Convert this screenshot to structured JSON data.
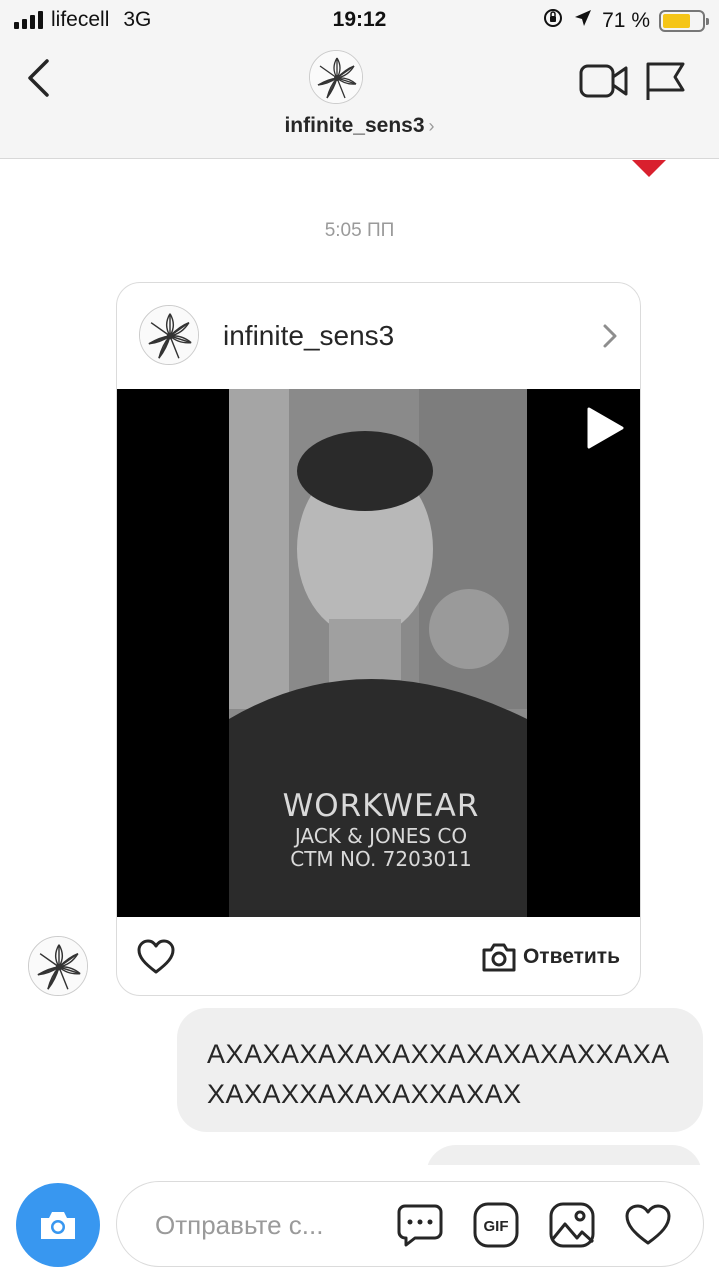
{
  "status_bar": {
    "carrier": "lifecell",
    "network": "3G",
    "time": "19:12",
    "battery_percent": "71 %",
    "battery_level": 0.71
  },
  "header": {
    "username": "infinite_sens3",
    "chevron": "›",
    "back_icon": "chevron-left-icon",
    "video_icon": "video-camera-icon",
    "flag_icon": "flag-icon"
  },
  "chat": {
    "timestamp": "5:05 ПП",
    "shared_post": {
      "username": "infinite_sens3",
      "shirt_line1": "WORKWEAR",
      "shirt_line2": "JACK & JONES CO",
      "shirt_line3": "CTM NO. 7203011",
      "reply_label": "Ответить"
    },
    "message_text": "АХАХАХАХАХАХХАХАХАХАХХАХАХАХАХХАХАХАХХАХАХ"
  },
  "composer": {
    "placeholder": "Отправьте с..."
  },
  "colors": {
    "accent": "#3897f0",
    "notification": "#d9202e",
    "bubble": "#efefef",
    "battery": "#f5c518"
  }
}
